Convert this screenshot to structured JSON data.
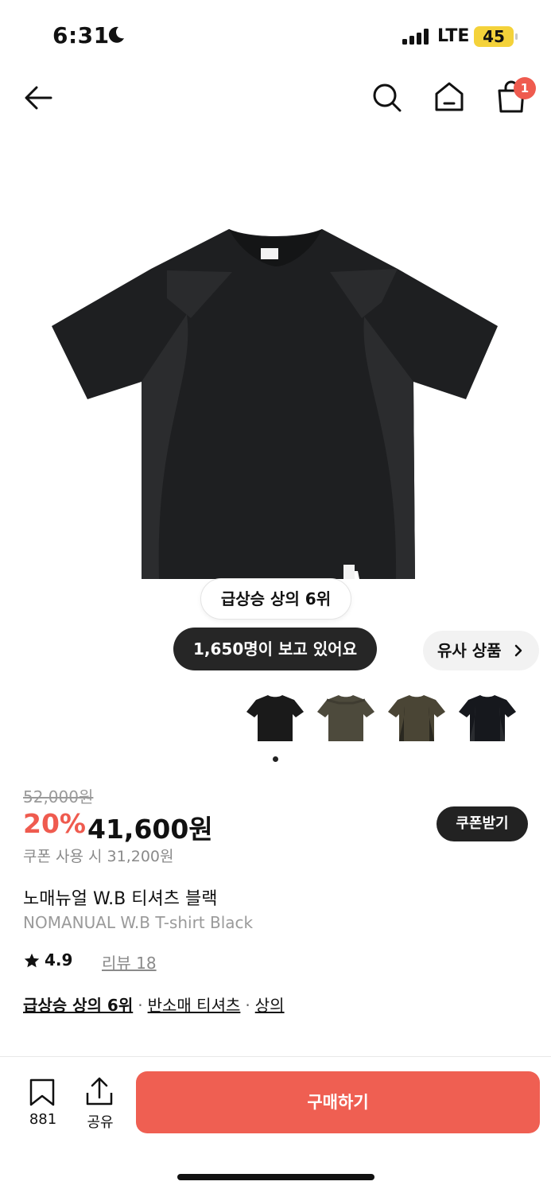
{
  "status_bar": {
    "time": "6:31",
    "carrier": "LTE",
    "battery": "45",
    "battery_color": "#f4d23a"
  },
  "header": {
    "icons": [
      "back-arrow-icon",
      "search-icon",
      "home-icon",
      "shopping-bag-icon"
    ],
    "cart_badge": "1"
  },
  "product": {
    "rank_chip": "급상승 상의 6위",
    "viewers": "1,650명이 보고 있어요",
    "similar": "유사 상품",
    "thumbnails": [
      {
        "color": "#1a1a1a",
        "accent": "#2b2b2b"
      },
      {
        "color": "#4d4a3c",
        "accent": "#3f3c31"
      },
      {
        "color": "#4a4535",
        "accent": "#2a2820"
      },
      {
        "color": "#16181d",
        "accent": "#2a2c30"
      }
    ],
    "gallery_page": 1,
    "original_price": "52,000원",
    "discount": "20%",
    "sale_price": "41,600원",
    "coupon_button": "쿠폰받기",
    "coupon_price": "쿠폰 사용 시 31,200원",
    "name_kr": "노매뉴얼 W.B 티셔츠 블랙",
    "name_en": "NOMANUAL W.B T-shirt Black",
    "rating": "4.9",
    "reviews": "리뷰 18",
    "tags": [
      "급상승 상의 6위",
      "반소매 티셔츠",
      "상의"
    ]
  },
  "bottom_bar": {
    "bookmark_count": "881",
    "share_label": "공유",
    "buy_button": "구매하기",
    "buy_color": "#ef5f52"
  }
}
